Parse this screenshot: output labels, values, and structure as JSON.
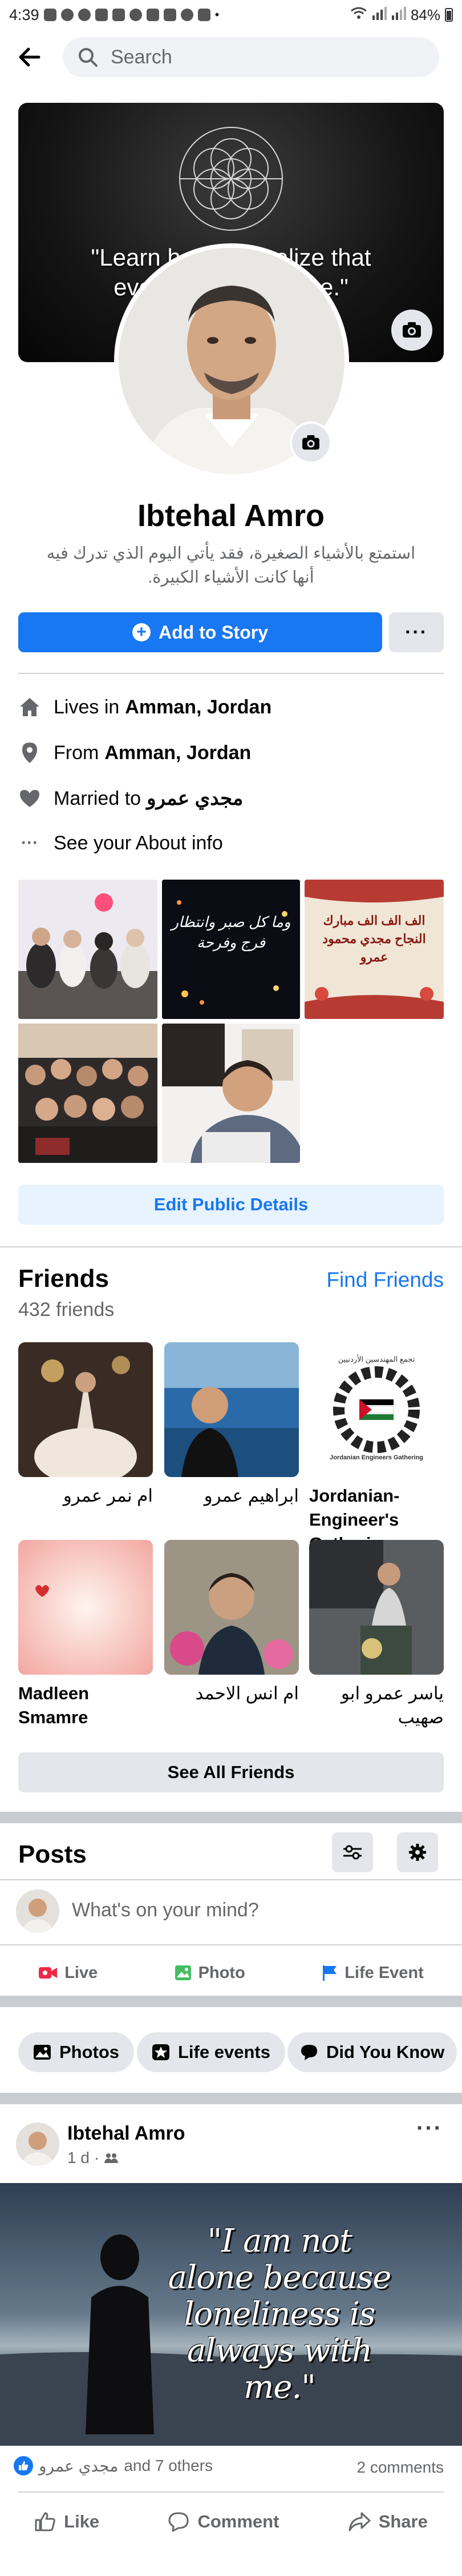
{
  "status_bar": {
    "time": "4:39",
    "battery": "84%"
  },
  "nav": {
    "search_placeholder": "Search"
  },
  "cover": {
    "quote_line1": "\"Learn how to   Realize that",
    "quote_line2": "everything      thing else.\""
  },
  "profile": {
    "name": "Ibtehal Amro",
    "bio": "استمتع بالأشياء الصغيرة، فقد يأتي اليوم الذي تدرك فيه أنها كانت الأشياء الكبيرة."
  },
  "actions": {
    "add_story": "Add to Story",
    "more": "···"
  },
  "about": {
    "lives_in_prefix": "Lives in",
    "lives_in": "Amman, Jordan",
    "from_prefix": "From",
    "from": "Amman, Jordan",
    "married_prefix": "Married to",
    "married": "مجدي عمرو",
    "see_about": "See your About info"
  },
  "photo_texts": {
    "p2": "وما كل صبر وانتظار فرج وفرحة",
    "p3": "الف الف الف مبارك النجاح مجدي محمود عمرو"
  },
  "edit_public": "Edit Public Details",
  "friends": {
    "title": "Friends",
    "find": "Find Friends",
    "count": "432 friends",
    "list": [
      {
        "name": "ام نمر عمرو"
      },
      {
        "name": "ابراهيم عمرو"
      },
      {
        "name": "Jordanian-Engineer's Gatheri…"
      },
      {
        "name": "Madleen Smamre"
      },
      {
        "name": "ام انس الاحمد"
      },
      {
        "name": "ياسر عمرو ابو صهيب"
      }
    ],
    "logo_text": "تجمع المهندسين الأردنيين",
    "logo_sub": "Jordanian Engineers Gathering",
    "see_all": "See All Friends"
  },
  "posts": {
    "title": "Posts",
    "composer_placeholder": "What's on your mind?",
    "live": "Live",
    "photo": "Photo",
    "life_event": "Life Event"
  },
  "chips": {
    "photos": "Photos",
    "life_events": "Life events",
    "did_you_know": "Did You Know"
  },
  "post": {
    "author": "Ibtehal Amro",
    "time": "1 d ·",
    "more": "···",
    "quote": "\"I am not alone because loneliness is always with me.\"",
    "reactions_name": "مجدي عمرو",
    "reactions_rest": "and 7 others",
    "comments": "2 comments",
    "like": "Like",
    "comment": "Comment",
    "share": "Share"
  },
  "colors": {
    "accent": "#1877f2",
    "muted": "#65676b",
    "divider": "#ced0d4"
  }
}
